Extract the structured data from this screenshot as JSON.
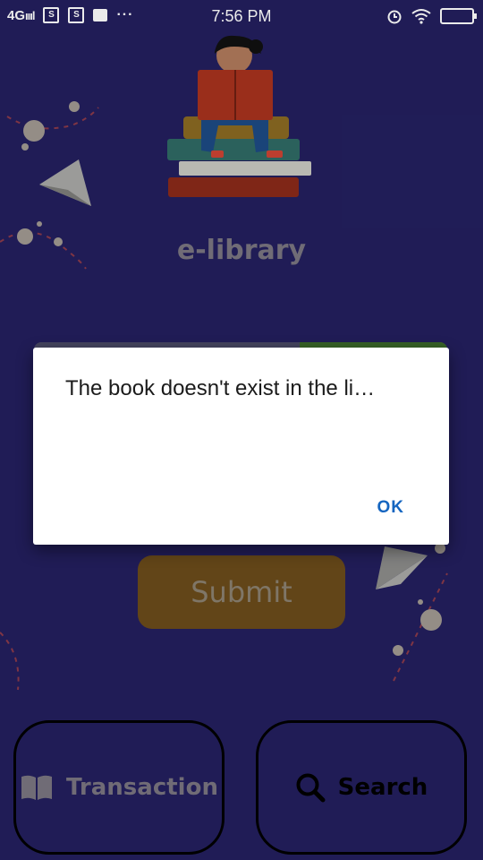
{
  "status_bar": {
    "network": "4G",
    "time": "7:56 PM",
    "box1": "S",
    "box2": "S",
    "dots": "···"
  },
  "app": {
    "title": "e-library"
  },
  "form": {
    "submit_label": "Submit"
  },
  "nav": {
    "transaction_label": "Transaction",
    "search_label": "Search",
    "transaction_icon": "book-open-icon",
    "search_icon": "search-icon"
  },
  "dialog": {
    "message": "The book doesn't exist in the li…",
    "ok_label": "OK"
  },
  "colors": {
    "background": "#231f5e",
    "dialog_accent": "#1565c0",
    "submit_bg": "#6b4b1b"
  }
}
